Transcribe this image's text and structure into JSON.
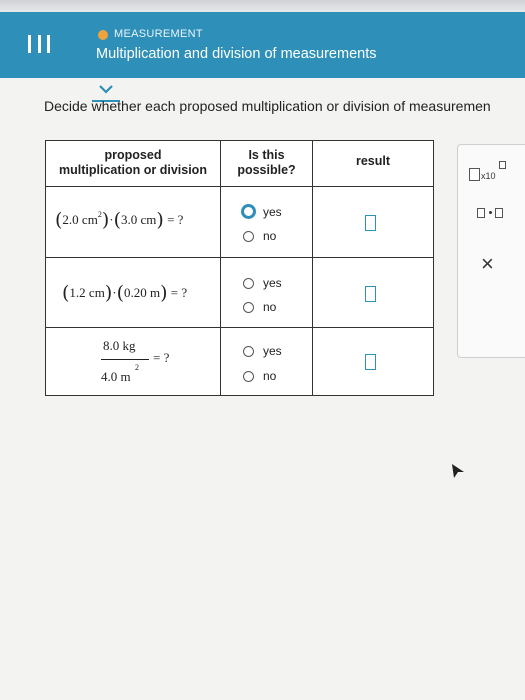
{
  "header": {
    "kicker": "MEASUREMENT",
    "title": "Multiplication and division of measurements"
  },
  "prompt": "Decide whether each proposed multiplication or division of measuremen",
  "table": {
    "headers": {
      "col1": [
        "proposed",
        "multiplication or division"
      ],
      "col2": [
        "Is this",
        "possible?"
      ],
      "col3": "result"
    },
    "rows": [
      {
        "expr": {
          "a": "2.0",
          "a_unit": "cm",
          "a_exp": "2",
          "dot": "·",
          "b": "3.0",
          "b_unit": "cm",
          "eq": "= ?"
        },
        "yes": "yes",
        "no": "no",
        "selected": "yes"
      },
      {
        "expr": {
          "a": "1.2",
          "a_unit": "cm",
          "dot": "·",
          "b": "0.20",
          "b_unit": "m",
          "eq": "= ?"
        },
        "yes": "yes",
        "no": "no",
        "selected": "none"
      },
      {
        "expr": {
          "num": "8.0 kg",
          "den": "4.0 m",
          "den_exp": "2",
          "eq": "= ?"
        },
        "yes": "yes",
        "no": "no",
        "selected": "none"
      }
    ]
  },
  "tools": {
    "sci_label": "x10",
    "close_symbol": "×"
  },
  "colors": {
    "header_bg": "#2e8fb8",
    "accent": "#2e8fb8",
    "dot": "#f2a23a"
  }
}
